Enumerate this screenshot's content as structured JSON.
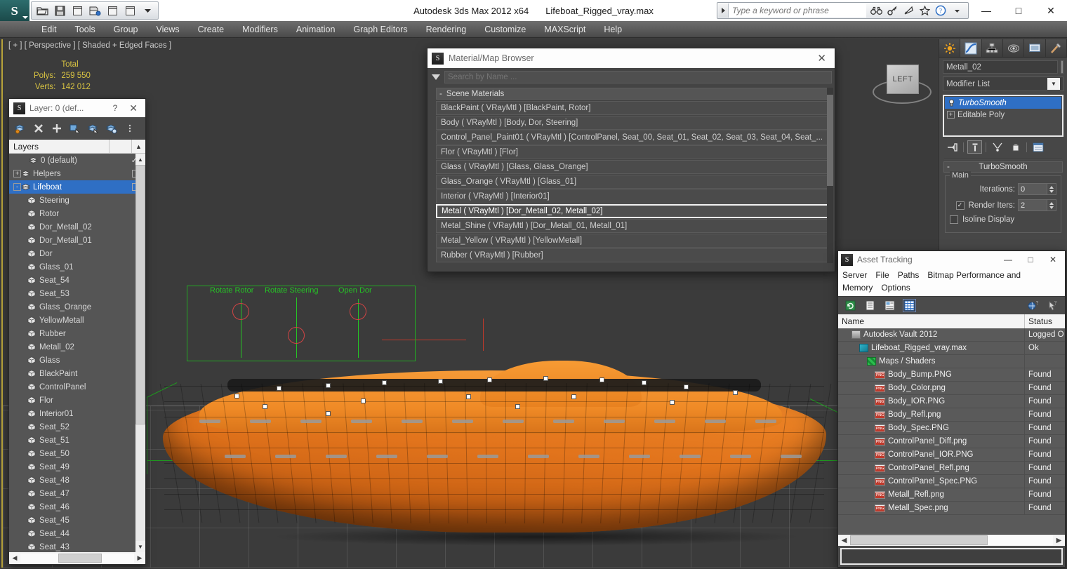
{
  "app": {
    "title": "Autodesk 3ds Max  2012 x64",
    "file": "Lifeboat_Rigged_vray.max",
    "logo_glyph": "S"
  },
  "quick_access": [
    {
      "name": "open-file-icon",
      "label": "Open File"
    },
    {
      "name": "save-file-icon",
      "label": "Save File"
    },
    {
      "name": "new-scene-icon",
      "label": "New Scene"
    },
    {
      "name": "save-as-icon",
      "label": "Save As"
    },
    {
      "name": "undo-icon",
      "label": "Undo"
    },
    {
      "name": "redo-icon",
      "label": "Redo"
    },
    {
      "name": "qat-dropdown-icon",
      "label": "Customize Quick Access Toolbar"
    }
  ],
  "search": {
    "placeholder": "Type a keyword or phrase",
    "icons": [
      "binoculars-icon",
      "key-icon",
      "satellite-dish-icon",
      "star-icon",
      "help-icon",
      "dropdown-icon"
    ]
  },
  "window_buttons": {
    "minimize": "—",
    "maximize": "□",
    "close": "✕"
  },
  "menu": [
    "Edit",
    "Tools",
    "Group",
    "Views",
    "Create",
    "Modifiers",
    "Animation",
    "Graph Editors",
    "Rendering",
    "Customize",
    "MAXScript",
    "Help"
  ],
  "viewport": {
    "label": "[ + ] [ Perspective ] [ Shaded + Edged Faces ]",
    "stats": {
      "header": "Total",
      "polys_label": "Polys:",
      "polys_value": "259 550",
      "verts_label": "Verts:",
      "verts_value": "142 012"
    },
    "viewcube": "LEFT",
    "manipulators": [
      {
        "label": "Rotate Rotor"
      },
      {
        "label": "Rotate Steering"
      },
      {
        "label": "Open Dor"
      }
    ],
    "colors": {
      "background": "#3b3b3b",
      "model_orange": "#e8801f",
      "helper_green": "#22aa22",
      "gizmo_red": "#d04444",
      "stats_yellow": "#d8c342"
    }
  },
  "layer_explorer": {
    "title": "Layer: 0 (def...",
    "help_glyph": "?",
    "close_glyph": "✕",
    "toolbar": [
      {
        "name": "create-new-layer-icon"
      },
      {
        "name": "delete-layer-icon"
      },
      {
        "name": "add-selection-to-layer-icon"
      },
      {
        "name": "select-objects-in-layer-icon"
      },
      {
        "name": "select-highlighted-objects-icon"
      },
      {
        "name": "highlight-selected-objects-icon"
      },
      {
        "name": "layer-options-icon"
      }
    ],
    "column_header": "Layers",
    "rows": [
      {
        "label": "0 (default)",
        "indent": 1,
        "type": "layer",
        "expander": "",
        "check": "✓",
        "box": false
      },
      {
        "label": "Helpers",
        "indent": 0,
        "type": "layer",
        "expander": "+",
        "check": "",
        "box": true
      },
      {
        "label": "Lifeboat",
        "indent": 0,
        "type": "layer",
        "expander": "-",
        "check": "",
        "box": true,
        "selected": true
      },
      {
        "label": "Steering",
        "indent": 2,
        "type": "object"
      },
      {
        "label": "Rotor",
        "indent": 2,
        "type": "object"
      },
      {
        "label": "Dor_Metall_02",
        "indent": 2,
        "type": "object"
      },
      {
        "label": "Dor_Metall_01",
        "indent": 2,
        "type": "object"
      },
      {
        "label": "Dor",
        "indent": 2,
        "type": "object"
      },
      {
        "label": "Glass_01",
        "indent": 2,
        "type": "object"
      },
      {
        "label": "Seat_54",
        "indent": 2,
        "type": "object"
      },
      {
        "label": "Seat_53",
        "indent": 2,
        "type": "object"
      },
      {
        "label": "Glass_Orange",
        "indent": 2,
        "type": "object"
      },
      {
        "label": "YellowMetall",
        "indent": 2,
        "type": "object"
      },
      {
        "label": "Rubber",
        "indent": 2,
        "type": "object"
      },
      {
        "label": "Metall_02",
        "indent": 2,
        "type": "object"
      },
      {
        "label": "Glass",
        "indent": 2,
        "type": "object"
      },
      {
        "label": "BlackPaint",
        "indent": 2,
        "type": "object"
      },
      {
        "label": "ControlPanel",
        "indent": 2,
        "type": "object"
      },
      {
        "label": "Flor",
        "indent": 2,
        "type": "object"
      },
      {
        "label": "Interior01",
        "indent": 2,
        "type": "object"
      },
      {
        "label": "Seat_52",
        "indent": 2,
        "type": "object"
      },
      {
        "label": "Seat_51",
        "indent": 2,
        "type": "object"
      },
      {
        "label": "Seat_50",
        "indent": 2,
        "type": "object"
      },
      {
        "label": "Seat_49",
        "indent": 2,
        "type": "object"
      },
      {
        "label": "Seat_48",
        "indent": 2,
        "type": "object"
      },
      {
        "label": "Seat_47",
        "indent": 2,
        "type": "object"
      },
      {
        "label": "Seat_46",
        "indent": 2,
        "type": "object"
      },
      {
        "label": "Seat_45",
        "indent": 2,
        "type": "object"
      },
      {
        "label": "Seat_44",
        "indent": 2,
        "type": "object"
      },
      {
        "label": "Seat_43",
        "indent": 2,
        "type": "object"
      }
    ]
  },
  "material_browser": {
    "title": "Material/Map Browser",
    "close_glyph": "✕",
    "search_placeholder": "Search by Name ...",
    "group_label": "Scene Materials",
    "group_minus": "-",
    "materials": [
      {
        "label": "BlackPaint  ( VRayMtl )  [BlackPaint, Rotor]"
      },
      {
        "label": "Body  ( VRayMtl )  [Body, Dor, Steering]"
      },
      {
        "label": "Control_Panel_Paint01  ( VRayMtl )  [ControlPanel, Seat_00, Seat_01, Seat_02, Seat_03, Seat_04, Seat_..."
      },
      {
        "label": "Flor  ( VRayMtl )  [Flor]"
      },
      {
        "label": "Glass  ( VRayMtl )  [Glass, Glass_Orange]"
      },
      {
        "label": "Glass_Orange  ( VRayMtl )  [Glass_01]"
      },
      {
        "label": "Interior  ( VRayMtl )  [Interior01]"
      },
      {
        "label": "Metal  ( VRayMtl )  [Dor_Metall_02, Metall_02]",
        "selected": true
      },
      {
        "label": "Metal_Shine  ( VRayMtl )  [Dor_Metall_01, Metall_01]"
      },
      {
        "label": "Metal_Yellow  ( VRayMtl )  [YellowMetall]"
      },
      {
        "label": "Rubber  ( VRayMtl )  [Rubber]"
      }
    ]
  },
  "command_panel": {
    "tabs": [
      {
        "name": "create-tab-icon",
        "label": "Create"
      },
      {
        "name": "modify-tab-icon",
        "label": "Modify",
        "active": true
      },
      {
        "name": "hierarchy-tab-icon",
        "label": "Hierarchy"
      },
      {
        "name": "motion-tab-icon",
        "label": "Motion"
      },
      {
        "name": "display-tab-icon",
        "label": "Display"
      },
      {
        "name": "utilities-tab-icon",
        "label": "Utilities"
      }
    ],
    "object_name": "Metall_02",
    "modifier_list_label": "Modifier List",
    "stack": [
      {
        "label": "TurboSmooth",
        "selected": true,
        "icon": "light-bulb-icon"
      },
      {
        "label": "Editable Poly",
        "selected": false,
        "expander": "+"
      }
    ],
    "stack_tools": [
      {
        "name": "pin-stack-icon"
      },
      {
        "name": "show-end-result-icon"
      },
      {
        "name": "make-unique-icon"
      },
      {
        "name": "remove-modifier-icon"
      },
      {
        "name": "configure-modifier-sets-icon"
      }
    ],
    "rollout": {
      "title": "TurboSmooth",
      "minus": "-",
      "group_label": "Main",
      "fields": [
        {
          "label": "Iterations:",
          "value": "0",
          "checkbox": null
        },
        {
          "label": "Render Iters:",
          "value": "2",
          "checkbox": true
        },
        {
          "label": "Isoline Display",
          "value": null,
          "checkbox": false
        }
      ]
    }
  },
  "asset_tracking": {
    "title": "Asset Tracking",
    "window_buttons": {
      "minimize": "—",
      "maximize": "□",
      "close": "✕"
    },
    "menu": [
      "Server",
      "File",
      "Paths",
      "Bitmap Performance and Memory",
      "Options"
    ],
    "toolbar": [
      {
        "name": "refresh-icon",
        "active": false
      },
      {
        "name": "list-view-icon",
        "active": false
      },
      {
        "name": "detail-view-icon",
        "active": false
      },
      {
        "name": "grid-view-icon",
        "active": true
      },
      {
        "name": "help-globe-icon",
        "active": false
      },
      {
        "name": "help-pointer-icon",
        "active": false
      }
    ],
    "columns": [
      "Name",
      "Status"
    ],
    "rows": [
      {
        "name": "Autodesk Vault 2012",
        "status": "Logged O",
        "indent": 1,
        "icon": "vault-icon"
      },
      {
        "name": "Lifeboat_Rigged_vray.max",
        "status": "Ok",
        "indent": 2,
        "icon": "max-file-icon"
      },
      {
        "name": "Maps / Shaders",
        "status": "",
        "indent": 3,
        "icon": "maps-shaders-icon"
      },
      {
        "name": "Body_Bump.PNG",
        "status": "Found",
        "indent": 4,
        "icon": "png-icon"
      },
      {
        "name": "Body_Color.png",
        "status": "Found",
        "indent": 4,
        "icon": "png-icon"
      },
      {
        "name": "Body_IOR.PNG",
        "status": "Found",
        "indent": 4,
        "icon": "png-icon"
      },
      {
        "name": "Body_Refl.png",
        "status": "Found",
        "indent": 4,
        "icon": "png-icon"
      },
      {
        "name": "Body_Spec.PNG",
        "status": "Found",
        "indent": 4,
        "icon": "png-icon"
      },
      {
        "name": "ControlPanel_Diff.png",
        "status": "Found",
        "indent": 4,
        "icon": "png-icon"
      },
      {
        "name": "ControlPanel_IOR.PNG",
        "status": "Found",
        "indent": 4,
        "icon": "png-icon"
      },
      {
        "name": "ControlPanel_Refl.png",
        "status": "Found",
        "indent": 4,
        "icon": "png-icon"
      },
      {
        "name": "ControlPanel_Spec.PNG",
        "status": "Found",
        "indent": 4,
        "icon": "png-icon"
      },
      {
        "name": "Metall_Refl.png",
        "status": "Found",
        "indent": 4,
        "icon": "png-icon"
      },
      {
        "name": "Metall_Spec.png",
        "status": "Found",
        "indent": 4,
        "icon": "png-icon"
      }
    ]
  }
}
